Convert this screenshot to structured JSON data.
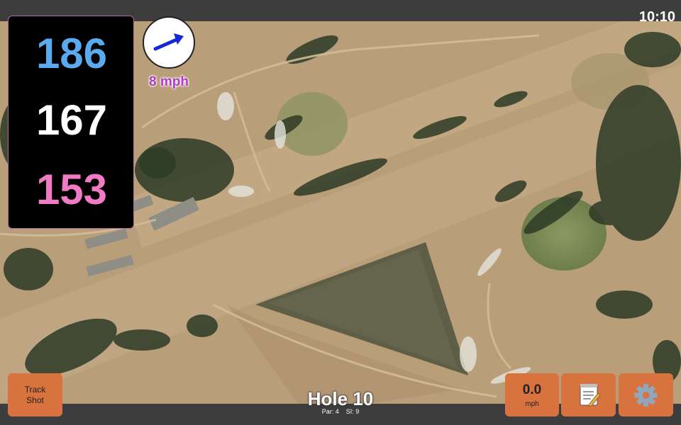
{
  "status_bar": {
    "time": "10:10"
  },
  "yardages": {
    "back": "186",
    "middle": "167",
    "front": "153"
  },
  "wind": {
    "speed_label": "8 mph",
    "direction_icon": "arrow-icon"
  },
  "buttons": {
    "track_shot_label": "Track Shot",
    "speed_value": "0.0",
    "speed_unit": "mph",
    "notes_icon": "notepad-icon",
    "settings_icon": "gear-icon"
  },
  "hole": {
    "title": "Hole 10",
    "par_label": "Par: 4",
    "si_label": "SI: 9"
  },
  "colors": {
    "back_yardage": "#5aaaf0",
    "middle_yardage": "#ffffff",
    "front_yardage": "#f07ac4",
    "wind_text": "#b03cc8",
    "button": "#d8723f"
  }
}
